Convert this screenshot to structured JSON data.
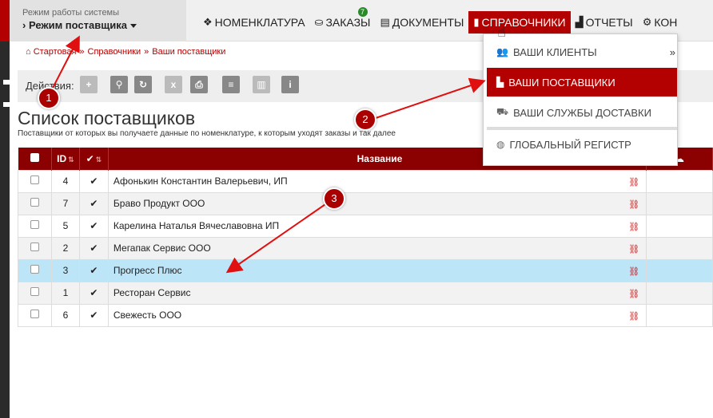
{
  "header": {
    "mode_label": "Режим работы системы",
    "mode_value": "Режим поставщика",
    "menu": [
      {
        "label": "НОМЕНКЛАТУРА",
        "icon": "cubes-icon"
      },
      {
        "label": "ЗАКАЗЫ",
        "icon": "basket-icon",
        "badge": "7"
      },
      {
        "label": "ДОКУМЕНТЫ",
        "icon": "document-icon"
      },
      {
        "label": "СПРАВОЧНИКИ",
        "icon": "book-icon"
      },
      {
        "label": "ОТЧЕТЫ",
        "icon": "chart-icon"
      },
      {
        "label": "КОН",
        "icon": "gears-icon"
      }
    ]
  },
  "breadcrumb": [
    "Стартовая",
    "Справочники",
    "Ваши поставщики"
  ],
  "toolbar": {
    "label": "Действия:"
  },
  "page": {
    "title": "Список поставщиков",
    "subtitle": "Поставщики от которых вы получаете данные по номенклатуре, к которым уходят заказы и так далее"
  },
  "table": {
    "headers": {
      "id": "ID",
      "name": "Название"
    },
    "rows": [
      {
        "id": "4",
        "name": "Афонькин Константин Валерьевич, ИП"
      },
      {
        "id": "7",
        "name": "Браво Продукт ООО"
      },
      {
        "id": "5",
        "name": "Карелина Наталья Вячеславовна ИП"
      },
      {
        "id": "2",
        "name": "Мегапак Сервис ООО"
      },
      {
        "id": "3",
        "name": "Прогресс Плюс"
      },
      {
        "id": "1",
        "name": "Ресторан Сервис"
      },
      {
        "id": "6",
        "name": "Свежесть ООО"
      }
    ]
  },
  "dropdown": {
    "items": [
      {
        "label": "ВАШИ КЛИЕНТЫ",
        "icon": "users-icon"
      },
      {
        "label": "ВАШИ ПОСТАВЩИКИ",
        "icon": "factory-icon"
      },
      {
        "label": "ВАШИ СЛУЖБЫ ДОСТАВКИ",
        "icon": "truck-icon"
      },
      {
        "label": "ГЛОБАЛЬНЫЙ РЕГИСТР",
        "icon": "globe-icon"
      }
    ]
  },
  "markers": [
    "1",
    "2",
    "3"
  ],
  "colors": {
    "accent": "#b30000",
    "header_dark": "#8b0000",
    "highlight": "#bde5f8"
  }
}
